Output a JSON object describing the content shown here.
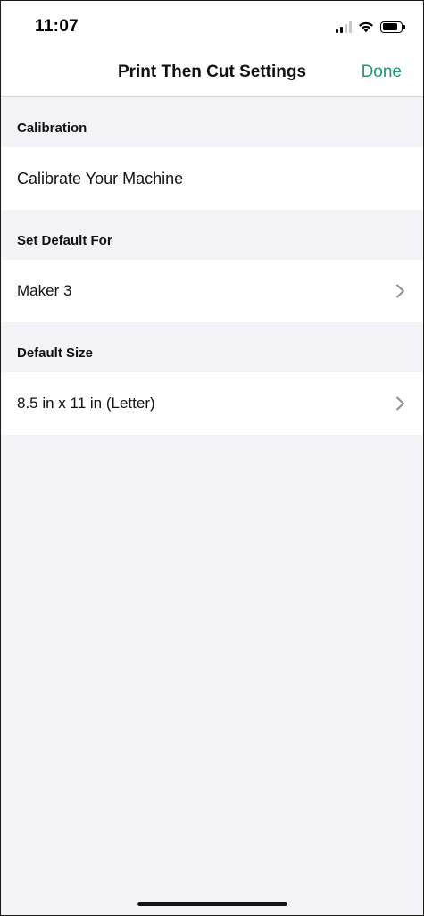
{
  "status_bar": {
    "time": "11:07",
    "signal_bars_active": 2,
    "signal_bars_total": 4,
    "battery_level": 0.8
  },
  "nav": {
    "title": "Print Then Cut Settings",
    "done_label": "Done",
    "accent_color": "#1e9a6e"
  },
  "sections": {
    "calibration": {
      "header": "Calibration",
      "row_label": "Calibrate Your Machine"
    },
    "default_for": {
      "header": "Set Default For",
      "row_label": "Maker 3",
      "row_icon": "chevron-right-icon"
    },
    "default_size": {
      "header": "Default Size",
      "row_label": "8.5 in x 11 in (Letter)",
      "row_icon": "chevron-right-icon"
    }
  }
}
